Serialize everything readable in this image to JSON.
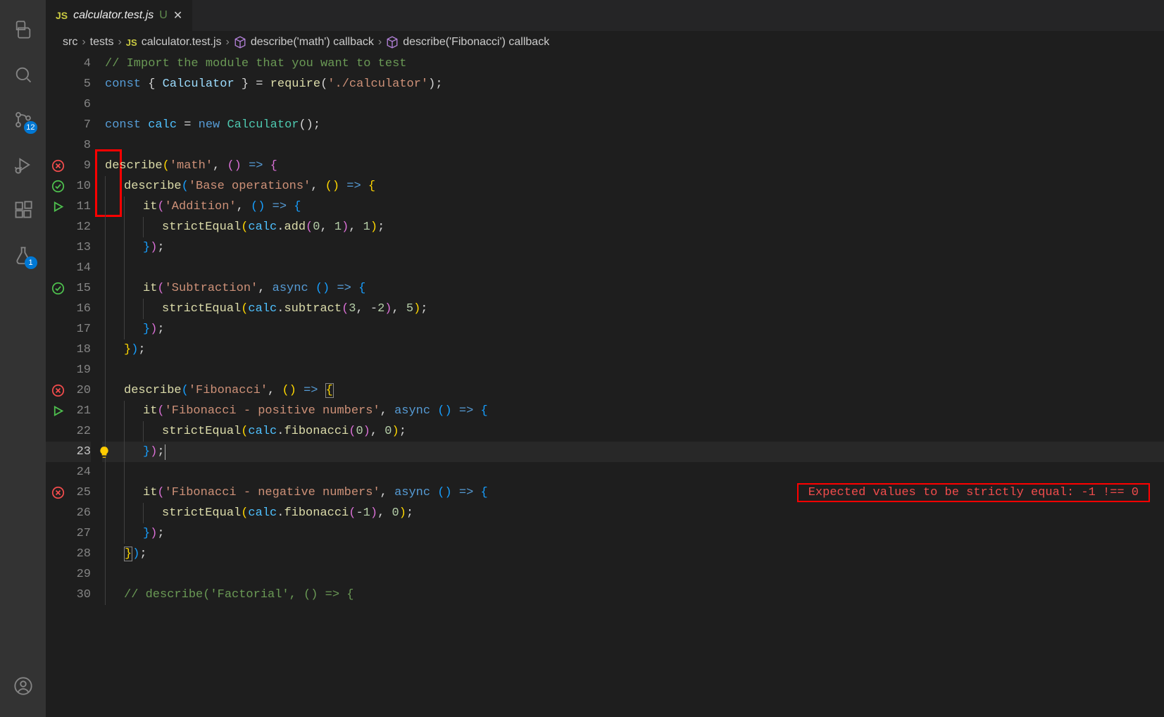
{
  "activity_bar": {
    "scm_badge": "12",
    "test_badge": "1"
  },
  "tab": {
    "icon_label": "JS",
    "name": "calculator.test.js",
    "modified_indicator": "U",
    "close": "✕"
  },
  "breadcrumbs": {
    "segments": [
      "src",
      "tests"
    ],
    "file_icon_label": "JS",
    "file": "calculator.test.js",
    "symbol1": "describe('math') callback",
    "symbol2": "describe('Fibonacci') callback",
    "sep": "›"
  },
  "gutter": {
    "9": "fail",
    "10": "pass",
    "11": "run",
    "15": "pass",
    "20": "fail",
    "21": "run",
    "25": "fail"
  },
  "line_numbers": [
    "4",
    "5",
    "6",
    "7",
    "8",
    "9",
    "10",
    "11",
    "12",
    "13",
    "14",
    "15",
    "16",
    "17",
    "18",
    "19",
    "20",
    "21",
    "22",
    "23",
    "24",
    "25",
    "26",
    "27",
    "28",
    "29",
    "30"
  ],
  "current_line_number": "23",
  "error_message": "Expected values to be strictly equal: -1 !== 0",
  "code": {
    "l4": "// Import the module that you want to test",
    "l5_const": "const",
    "l5_calc": "Calculator",
    "l5_req": "require",
    "l5_str": "'./calculator'",
    "l7_const": "const",
    "l7_calc": "calc",
    "l7_new": "new",
    "l7_type": "Calculator",
    "describe": "describe",
    "it": "it",
    "strictEqual": "strictEqual",
    "l9_str": "'math'",
    "l10_str": "'Base operations'",
    "l11_str": "'Addition'",
    "l12_add": "add",
    "l12_arg0": "0",
    "l12_arg1": "1",
    "l12_exp": "1",
    "l15_str": "'Subtraction'",
    "l16_sub": "subtract",
    "l16_a": "3",
    "l16_b": "-2",
    "l16_exp": "5",
    "l20_str": "'Fibonacci'",
    "l21_str": "'Fibonacci - positive numbers'",
    "l22_fib": "fibonacci",
    "l22_a": "0",
    "l22_exp": "0",
    "l25_str": "'Fibonacci - negative numbers'",
    "l26_a": "-1",
    "l26_exp": "0",
    "l30": "// describe('Factorial', () => {",
    "async": "async",
    "arrow": "=>"
  }
}
